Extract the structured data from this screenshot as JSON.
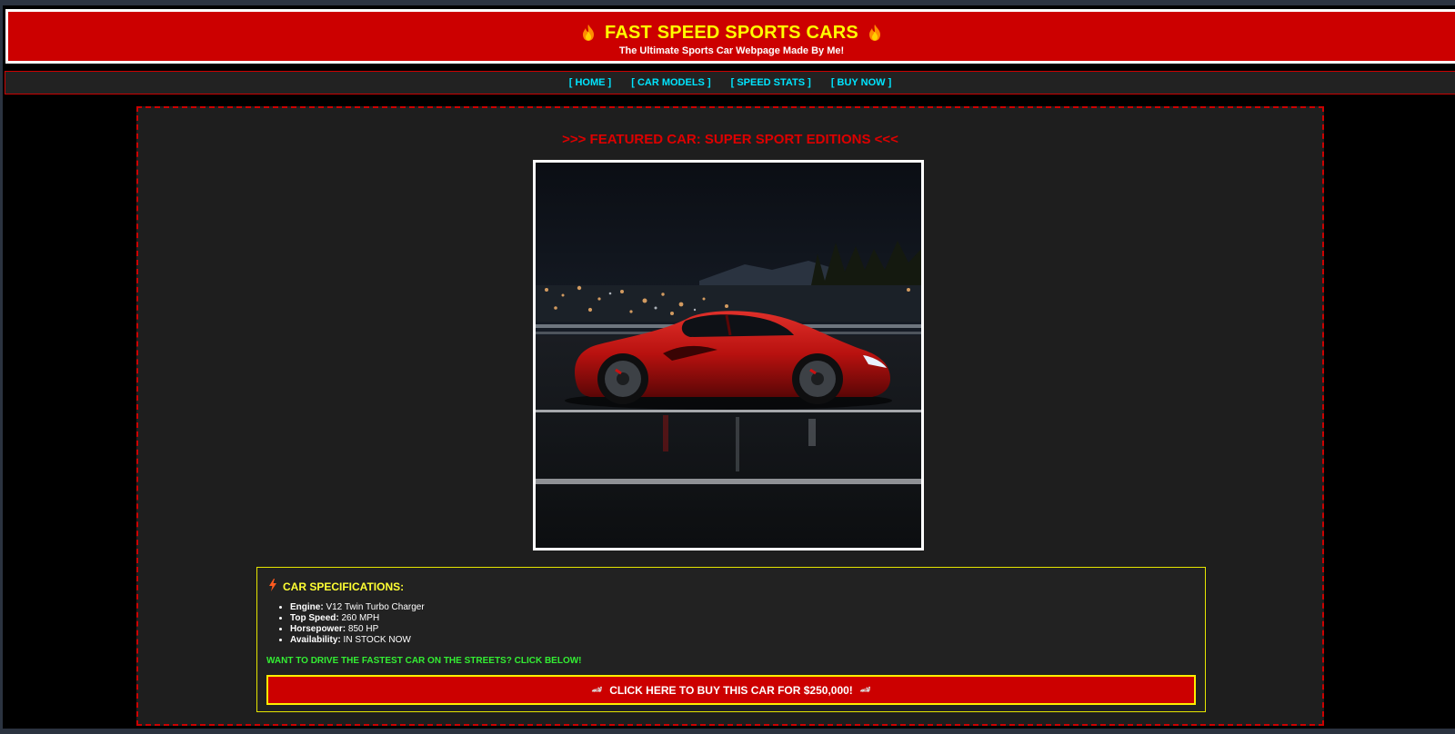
{
  "header": {
    "title": "FAST SPEED SPORTS CARS",
    "subtitle": "The Ultimate Sports Car Webpage Made By Me!",
    "title_icon": "fire-icon"
  },
  "nav": {
    "items": [
      {
        "label": "[ HOME ]"
      },
      {
        "label": "[ CAR MODELS ]"
      },
      {
        "label": "[ SPEED STATS ]"
      },
      {
        "label": "[ BUY NOW ]"
      }
    ]
  },
  "featured": {
    "title": ">>> FEATURED CAR: SUPER SPORT EDITIONS <<<",
    "image": "red sports car at night on a wet road"
  },
  "specs": {
    "heading": "CAR SPECIFICATIONS:",
    "heading_icon": "lightning-icon",
    "items": [
      {
        "label": "Engine:",
        "value": " V12 Twin Turbo Charger"
      },
      {
        "label": "Top Speed:",
        "value": " 260 MPH"
      },
      {
        "label": "Horsepower:",
        "value": " 850 HP"
      },
      {
        "label": "Availability:",
        "value": " IN STOCK NOW"
      }
    ],
    "cta_text": "WANT TO DRIVE THE FASTEST CAR ON THE STREETS? CLICK BELOW!",
    "buy_button_label": "CLICK HERE TO BUY THIS CAR FOR $250,000!",
    "buy_button_icon": "car-icon"
  },
  "colors": {
    "brand_red": "#cc0000",
    "title_yellow": "#ffff00",
    "nav_cyan": "#00e5ff",
    "cta_green": "#33ee33",
    "background": "#000000",
    "panel": "#1e1e1e"
  }
}
